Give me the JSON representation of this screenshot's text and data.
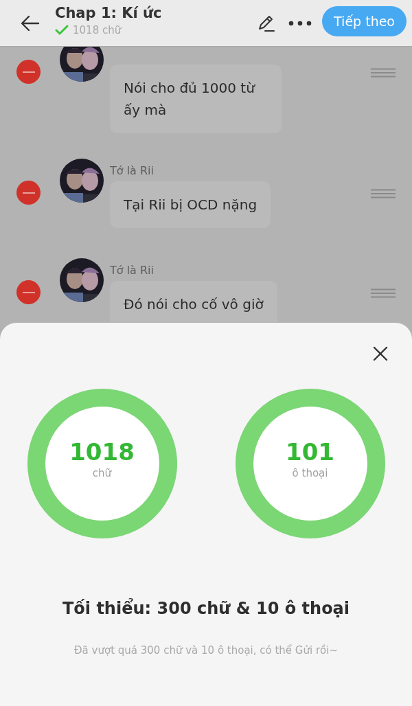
{
  "header": {
    "title": "Chap 1: Kí ức",
    "word_count": "1018 chữ",
    "next_button": "Tiếp theo"
  },
  "messages": [
    {
      "text": "Nói cho đủ 1000 từ ấy mà"
    },
    {
      "author": "Tớ là Rii",
      "text": "Tại Rii bị OCD nặng"
    },
    {
      "author": "Tớ là Rii",
      "text": "Đó nói cho cố vô giờ"
    }
  ],
  "sheet": {
    "stats": [
      {
        "value": "1018",
        "label": "chữ",
        "level": 1
      },
      {
        "value": "101",
        "label": "ô thoại",
        "level": 1
      }
    ],
    "minimum": "Tối thiểu: 300 chữ & 10 ô thoại",
    "note": "Đã vượt quá 300 chữ và 10 ô thoại, có thể Gửi rồi~"
  }
}
